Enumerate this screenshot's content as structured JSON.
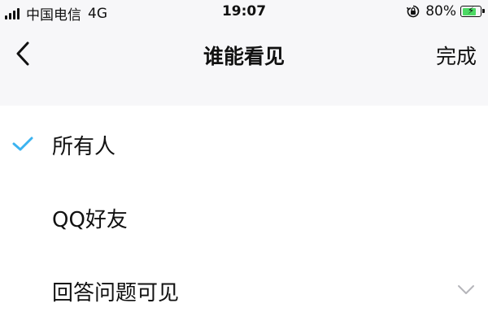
{
  "status_bar": {
    "carrier": "中国电信",
    "network": "4G",
    "time": "19:07",
    "battery": "80%",
    "battery_level": 0.8
  },
  "nav": {
    "title": "谁能看见",
    "done_label": "完成"
  },
  "options": [
    {
      "label": "所有人",
      "selected": true
    },
    {
      "label": "QQ好友",
      "selected": false
    },
    {
      "label": "回答问题可见",
      "selected": false,
      "expandable": true
    }
  ],
  "colors": {
    "accent": "#3bb3f0",
    "background": "#f7f7f9",
    "battery_fill": "#4cd964"
  },
  "icons": [
    "signal-icon",
    "orientation-lock-icon",
    "battery-icon",
    "back-chevron-icon",
    "check-icon",
    "chevron-down-icon"
  ]
}
